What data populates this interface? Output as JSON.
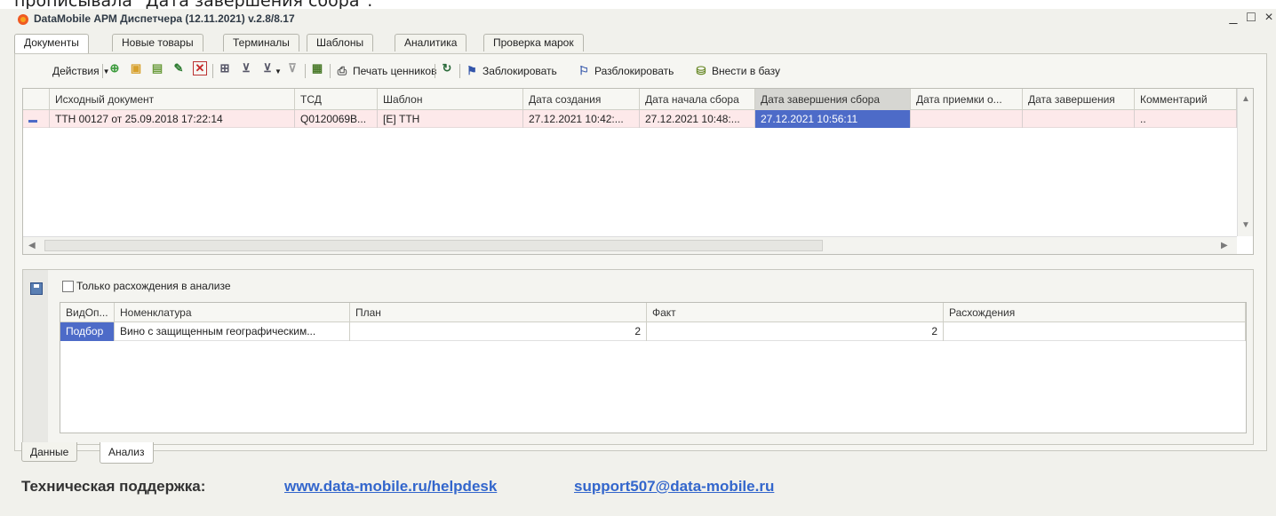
{
  "caption_fragment": "прописывала \"Дата завершения сбора\".",
  "window": {
    "title": "DataMobile АРМ Диспетчера (12.11.2021) v.2.8/8.17",
    "minimize": "_",
    "maximize": "□",
    "close": "×"
  },
  "top_tabs": [
    "Документы",
    "Новые товары",
    "Терминалы",
    "Шаблоны",
    "Аналитика",
    "Проверка марок"
  ],
  "toolbar": {
    "actions_label": "Действия",
    "print_prices_label": "Печать ценников",
    "lock_label": "Заблокировать",
    "unlock_label": "Разблокировать",
    "to_base_label": "Внести в базу"
  },
  "documents_grid": {
    "columns": [
      "Исходный документ",
      "ТСД",
      "Шаблон",
      "Дата создания",
      "Дата начала сбора",
      "Дата завершения сбора",
      "Дата приемки о...",
      "Дата завершения",
      "Комментарий"
    ],
    "rows": [
      {
        "source_doc": "ТТН 00127 от 25.09.2018 17:22:14",
        "tsd": "Q0120069B...",
        "template": "[Е] ТТН",
        "created": "27.12.2021 10:42:...",
        "start": "27.12.2021 10:48:...",
        "finish": "27.12.2021 10:56:11",
        "accept": "",
        "complete": "",
        "comment": ".."
      }
    ]
  },
  "analysis": {
    "only_diff_label": "Только расхождения в анализе",
    "columns": [
      "ВидОп...",
      "Номенклатура",
      "План",
      "Факт",
      "Расхождения"
    ],
    "rows": [
      {
        "op": "Подбор",
        "item": "Вино с защищенным географическим...",
        "plan": "2",
        "fact": "2",
        "diff": ""
      }
    ]
  },
  "bottom_tabs": [
    "Данные",
    "Анализ"
  ],
  "support": {
    "label": "Техническая поддержка:",
    "helpdesk": "www.data-mobile.ru/helpdesk",
    "email": "support507@data-mobile.ru"
  },
  "colors": {
    "selected_cell": "#4d6bc8",
    "row_highlight": "#fde9ea",
    "link": "#3366cc"
  }
}
